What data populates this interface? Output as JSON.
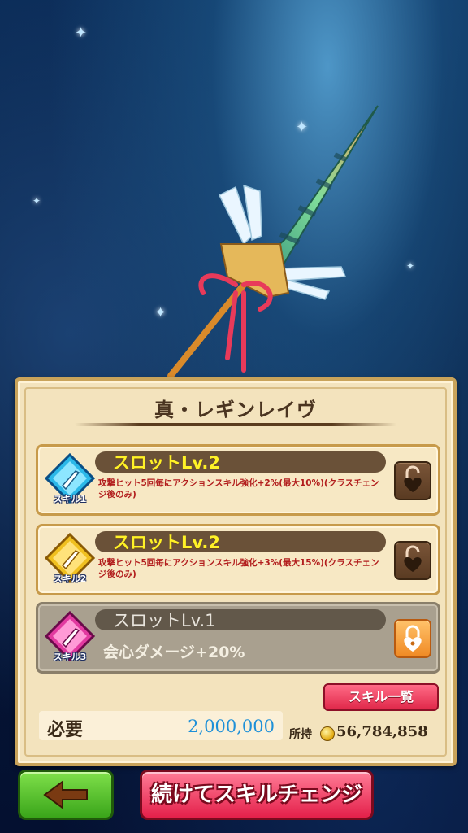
{
  "weapon": {
    "name": "真・レギンレイヴ"
  },
  "skills": [
    {
      "badge": "スキル1",
      "slot": "スロットLv.2",
      "description": "攻撃ヒット5回毎にアクションスキル強化+2%(最大10%)(クラスチェンジ後のみ)",
      "lock_icon": "unlocked-heart-lock-icon"
    },
    {
      "badge": "スキル2",
      "slot": "スロットLv.2",
      "description": "攻撃ヒット5回毎にアクションスキル強化+3%(最大15%)(クラスチェンジ後のみ)",
      "lock_icon": "unlocked-heart-lock-icon"
    },
    {
      "badge": "スキル3",
      "slot": "スロットLv.1",
      "description": "会心ダメージ+20%",
      "lock_icon": "locked-heart-lock-icon"
    }
  ],
  "buttons": {
    "skill_list": "スキル一覧",
    "continue": "続けてスキルチェンジ"
  },
  "cost": {
    "label": "必要",
    "value": "2,000,000",
    "owned_label": "所持",
    "owned_value": "56,784,858"
  },
  "colors": {
    "slot_text": "#fff227",
    "desc_text": "#b21d1d",
    "cost_value": "#1e90d8",
    "back_button": "#3aa51a",
    "continue_button": "#e4204a"
  }
}
